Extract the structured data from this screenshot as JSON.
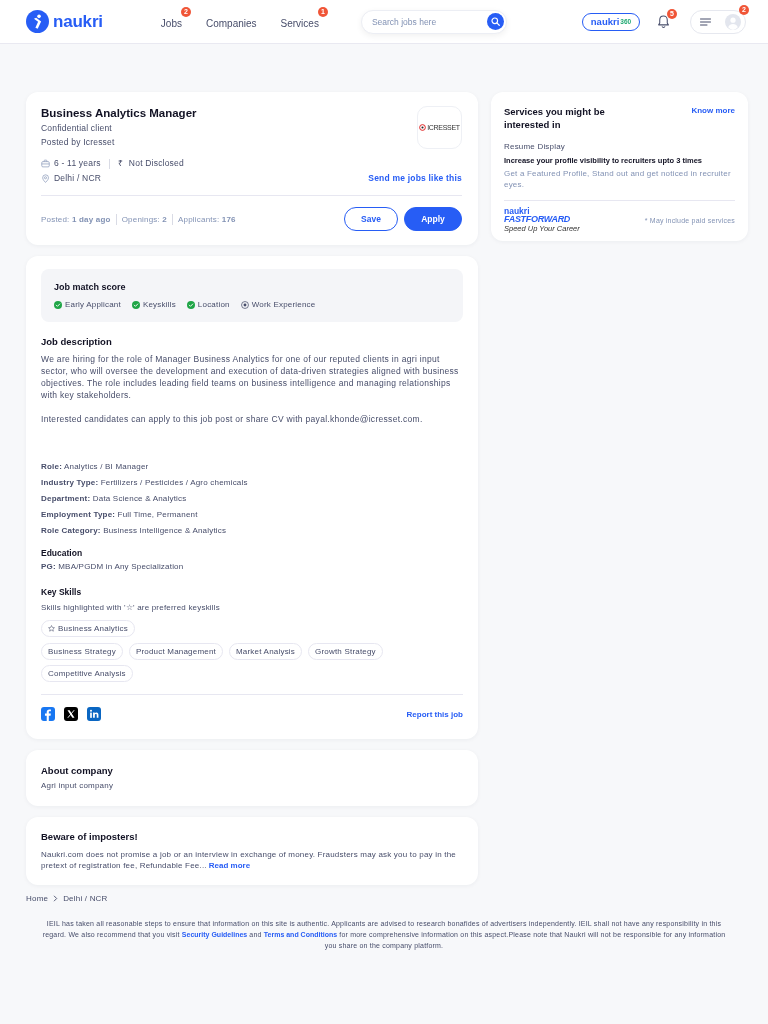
{
  "header": {
    "logo_text": "naukri",
    "nav": [
      {
        "label": "Jobs",
        "badge": "2"
      },
      {
        "label": "Companies"
      },
      {
        "label": "Services",
        "badge": "1"
      }
    ],
    "search": {
      "placeholder": "Search jobs here"
    },
    "naukri360": {
      "text": "naukri",
      "suffix": "360"
    },
    "notification_badge": "5",
    "menu_badge": "2"
  },
  "job_card": {
    "title": "Business Analytics Manager",
    "company": "Confidential client",
    "posted_by": "Posted by Icresset",
    "logo_text": "ICRESSET",
    "experience": "6 - 11 years",
    "currency": "₹",
    "salary": "Not Disclosed",
    "location": "Delhi / NCR",
    "alert_link": "Send me jobs like this",
    "stats": [
      "Posted: **1 day ago**",
      "Openings: **2**",
      "Applicants: **176**"
    ],
    "buttons": [
      {
        "label": "Save",
        "kind": "outline"
      },
      {
        "label": "Apply",
        "kind": "primary"
      }
    ]
  },
  "services": {
    "title": "Services you might be interested in",
    "link": "Know more",
    "service_name": "Resume Display",
    "headline": "Increase your profile visibility to recruiters upto 3 times",
    "description": "Get a Featured Profile, Stand out and get noticed in recruiter eyes.",
    "logo": {
      "brand": "naukri",
      "name": "FASTFORWARD",
      "tagline": "Speed Up Your Career"
    },
    "note": "* May include paid services"
  },
  "match_score": {
    "title": "Job match score",
    "items": [
      {
        "label": "Early Applicant",
        "matched": true
      },
      {
        "label": "Keyskills",
        "matched": true
      },
      {
        "label": "Location",
        "matched": true
      },
      {
        "label": "Work Experience",
        "matched": false
      }
    ]
  },
  "description": {
    "title": "Job description",
    "paragraphs": [
      "We are hiring for the role of Manager Business Analytics for one of our reputed clients in agri input sector, who will oversee the development and execution of data-driven strategies aligned with business objectives. The role includes leading field teams on business intelligence and managing relationships with key stakeholders.",
      "Interested candidates can apply to this job post or share CV with payal.khonde@icresset.com."
    ]
  },
  "details": [
    "**Role:** Analytics / BI Manager",
    "**Industry Type:** Fertilizers / Pesticides / Agro chemicals",
    "**Department:** Data Science & Analytics",
    "**Employment Type:** Full Time, Permanent",
    "**Role Category:** Business Intelligence & Analytics"
  ],
  "education": {
    "title": "Education",
    "lines": [
      "**PG:** MBA/PGDM in Any Specialization"
    ]
  },
  "key_skills": {
    "title": "Key Skills",
    "note": "Skills highlighted with '☆' are preferred keyskills",
    "skills": [
      {
        "label": "Business Analytics",
        "preferred": true
      },
      {
        "label": "Business Strategy",
        "preferred": false
      },
      {
        "label": "Product Management",
        "preferred": false
      },
      {
        "label": "Market Analysis",
        "preferred": false
      },
      {
        "label": "Growth Strategy",
        "preferred": false
      },
      {
        "label": "Competitive Analysis",
        "preferred": false
      }
    ]
  },
  "report_link": "Report this job",
  "about_company": {
    "title": "About company",
    "text": "Agri input company"
  },
  "imposters": {
    "title": "Beware of imposters!",
    "text": "Naukri.com does not promise a job or an interview in exchange of money. Fraudsters may ask you to pay in the pretext of registration fee, Refundable Fee...",
    "link": "Read more"
  },
  "breadcrumb": [
    "Home",
    "Delhi / NCR"
  ],
  "disclaimer": [
    {
      "kind": "text",
      "text": "IEIL has taken all reasonable steps to ensure that information on this site is authentic. Applicants are advised to research bonafides of advertisers independently. IEIL shall not have any responsibility in this regard. We also recommend that you visit "
    },
    {
      "kind": "link",
      "text": "Security Guidelines"
    },
    {
      "kind": "text",
      "text": " and "
    },
    {
      "kind": "link",
      "text": "Terms and Conditions"
    },
    {
      "kind": "text",
      "text": " for more comprehensive information on this aspect.Please note that Naukri will not be responsible for any information you share on the company platform."
    }
  ]
}
